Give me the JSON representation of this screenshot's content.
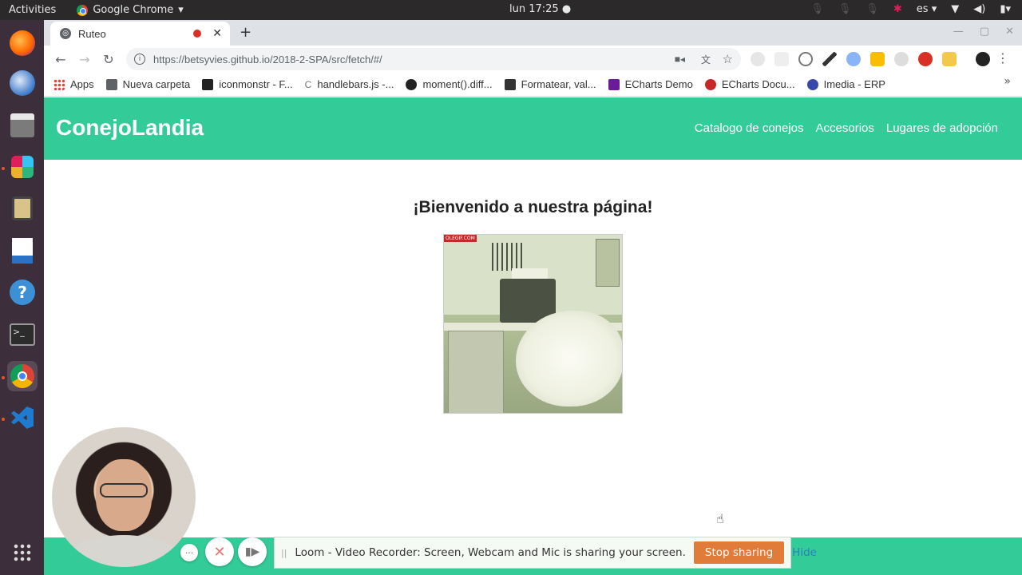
{
  "system_bar": {
    "activities": "Activities",
    "app_name": "Google Chrome",
    "app_arrow": "▾",
    "clock": "lun 17:25 ●",
    "lang": "es ▾"
  },
  "browser": {
    "tab": {
      "title": "Ruteo",
      "close": "✕",
      "new_tab": "+"
    },
    "url_host": "https://betsyvies.github.io",
    "url_path": "/2018-2-SPA/src/fetch/#/",
    "bookmarks": [
      {
        "label": "Apps",
        "icon": "apps-grid-icon",
        "color": "#e94235"
      },
      {
        "label": "Nueva carpeta",
        "icon": "folder-icon",
        "color": "#5f6368"
      },
      {
        "label": "iconmonstr - F...",
        "icon": "iconmonstr-icon",
        "color": "#222222"
      },
      {
        "label": "handlebars.js -...",
        "icon": "handlebars-icon",
        "color": "#777777"
      },
      {
        "label": "moment().diff...",
        "icon": "github-icon",
        "color": "#222222"
      },
      {
        "label": "Formatear, val...",
        "icon": "bookmark-icon",
        "color": "#333333"
      },
      {
        "label": "ECharts Demo",
        "icon": "echarts-icon",
        "color": "#6a1b9a"
      },
      {
        "label": "ECharts Docu...",
        "icon": "echarts-docs-icon",
        "color": "#c62828"
      },
      {
        "label": "Imedia - ERP",
        "icon": "imedia-icon",
        "color": "#3949ab"
      }
    ],
    "bookmarks_more": "»"
  },
  "page": {
    "brand": "ConejoLandia",
    "nav": [
      "Catalogo de conejos",
      "Accesorios",
      "Lugares de adopción"
    ],
    "heading": "¡Bienvenido a nuestra página!",
    "gif_watermark": "OLEGIF.COM"
  },
  "loom": {
    "grip": "||",
    "message": "Loom - Video Recorder: Screen, Webcam and Mic is sharing your screen.",
    "stop_label": "Stop sharing",
    "hide_label": "Hide"
  },
  "colors": {
    "accent": "#33cc99",
    "stop_button": "#e07b39",
    "dock": "#3c2e3a"
  }
}
